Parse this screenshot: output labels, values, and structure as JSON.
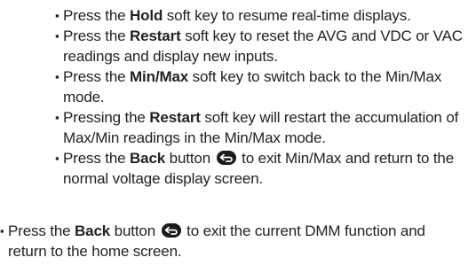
{
  "sub_items": [
    {
      "before": "Press the ",
      "key": "Hold",
      "after": " soft key to resume real-time displays."
    },
    {
      "before": "Press the ",
      "key": "Restart",
      "after": " soft key to reset the AVG and VDC or VAC readings and display new inputs."
    },
    {
      "before": "Press the ",
      "key": "Min/Max",
      "after": " soft key to switch back to the Min/Max mode."
    },
    {
      "before": "Pressing the ",
      "key": "Restart",
      "after": " soft key will restart the accumulation of Max/Min readings in the Min/Max mode."
    },
    {
      "before": "Press the ",
      "key": "Back",
      "middle": " button ",
      "icon": "back-arrow-icon",
      "after": " to exit Min/Max and return to the normal voltage display screen."
    }
  ],
  "main_item": {
    "before": "Press the ",
    "key": "Back",
    "middle": " button ",
    "icon": "back-arrow-icon",
    "after": " to exit the current DMM function and return to the home screen."
  },
  "bullet": "▪",
  "colors": {
    "text": "#222222",
    "icon_fill": "#1a1a1a",
    "icon_arrow": "#ffffff"
  }
}
